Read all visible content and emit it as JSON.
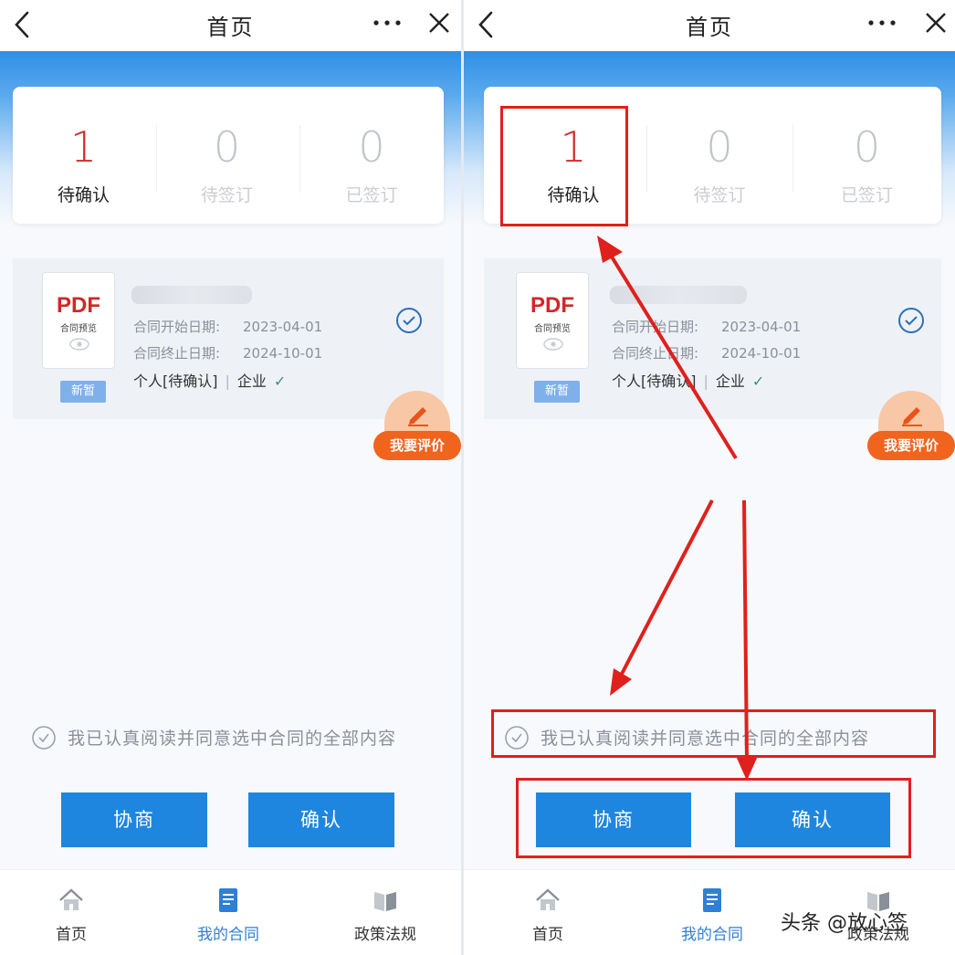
{
  "header": {
    "title": "首页"
  },
  "stats": [
    {
      "value": "1",
      "label": "待确认"
    },
    {
      "value": "0",
      "label": "待签订"
    },
    {
      "value": "0",
      "label": "已签订"
    }
  ],
  "contract": {
    "file_type": "PDF",
    "file_sub": "合同预览",
    "tag": "新暂",
    "start_label": "合同开始日期:",
    "start_value": "2023-04-01",
    "end_label": "合同终止日期:",
    "end_value": "2024-10-01",
    "party_personal": "个人[待确认]",
    "party_company": "企业",
    "party_tick": "✓"
  },
  "review_button": "我要评价",
  "agreement": "我已认真阅读并同意选中合同的全部内容",
  "buttons": {
    "negotiate": "协商",
    "confirm": "确认"
  },
  "tabs": [
    {
      "label": "首页",
      "icon": "home-icon"
    },
    {
      "label": "我的合同",
      "icon": "contract-doc-icon"
    },
    {
      "label": "政策法规",
      "icon": "book-icon"
    }
  ],
  "watermark": "头条 @放心签",
  "colors": {
    "accent": "#1f86e0",
    "pending": "#d42a2a",
    "review": "#f0641e",
    "highlight": "#e0201c"
  }
}
